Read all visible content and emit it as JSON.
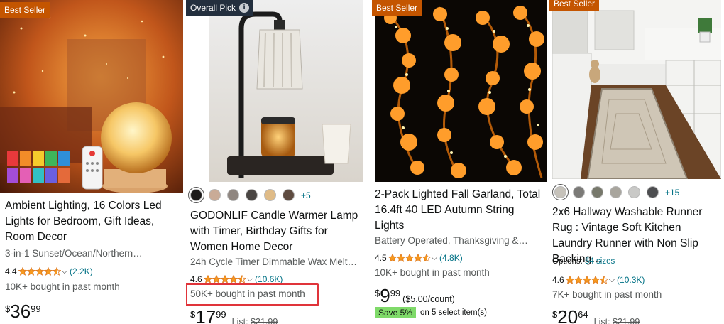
{
  "colors": {
    "best_seller_bg": "#c45500",
    "overall_pick_bg": "#232f3e",
    "star": "#f79a1e",
    "link": "#007185",
    "highlight_box": "#e0343a",
    "save_badge": "#7fda69"
  },
  "products": [
    {
      "badge": "Best Seller",
      "title": "Ambient Lighting, 16 Colors Led Lights for Bedroom, Gift Ideas, Room Decor",
      "subtitle": "3-in-1 Sunset/Ocean/Northern…",
      "rating": "4.4",
      "stars": 4.5,
      "review_count": "(2.2K)",
      "bought": "10K+ bought in past month",
      "price_symbol": "$",
      "price_whole": "36",
      "price_fraction": "99"
    },
    {
      "badge": "Overall Pick",
      "badge_icon": "info-icon",
      "more_colors": "+5",
      "title": "GODONLIF Candle Warmer Lamp with Timer, Birthday Gifts for Women Home Decor",
      "subtitle": "24h Cycle Timer Dimmable Wax Melt…",
      "rating": "4.6",
      "stars": 4.5,
      "review_count": "(10.6K)",
      "bought": "50K+ bought in past month",
      "price_symbol": "$",
      "price_whole": "17",
      "price_fraction": "99",
      "list_label": "List:",
      "list_price": "$21.99"
    },
    {
      "badge": "Best Seller",
      "title": "2-Pack Lighted Fall Garland, Total 16.4ft 40 LED Autumn String Lights",
      "subtitle": "Battery Operated, Thanksgiving &…",
      "rating": "4.5",
      "stars": 4.5,
      "review_count": "(4.8K)",
      "bought": "10K+ bought in past month",
      "price_symbol": "$",
      "price_whole": "9",
      "price_fraction": "99",
      "unit_price": "($5.00/count)",
      "save_badge": "Save 5%",
      "save_text": "on 5 select item(s)"
    },
    {
      "badge": "Best Seller",
      "more_colors": "+15",
      "title": "2x6 Hallway Washable Runner Rug : Vintage Soft Kitchen Laundry Runner with Non Slip Backing…",
      "options_label": "Options:",
      "options_link": "54 sizes",
      "rating": "4.6",
      "stars": 4.5,
      "review_count": "(10.3K)",
      "bought": "7K+ bought in past month",
      "price_symbol": "$",
      "price_whole": "20",
      "price_fraction": "64",
      "list_label": "List:",
      "list_price": "$21.99"
    }
  ],
  "swatches_p2": [
    "#1c1a19",
    "#c9ab97",
    "#8f8680",
    "#4a4643",
    "#dfbb87",
    "#5e4b40"
  ],
  "swatches_p4": [
    "#c6c2ba",
    "#7b7a77",
    "#77786b",
    "#a8a59d",
    "#c9c9c7",
    "#4d4e50"
  ]
}
